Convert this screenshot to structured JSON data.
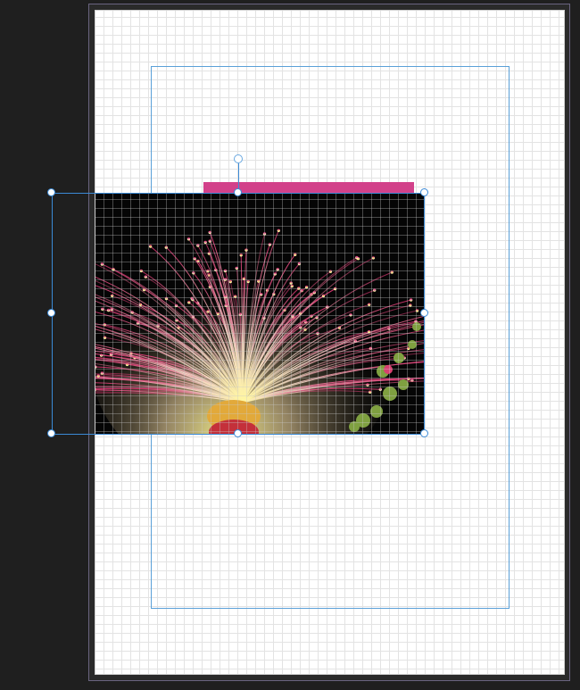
{
  "app": {
    "view": "layout-canvas"
  },
  "canvas": {
    "background_color": "#1f1f1f",
    "page_color": "#ffffff",
    "grid_color": "#e3e3e3",
    "guide_color": "#5aa0d8",
    "selection_color": "#3b8ad6"
  },
  "elements": {
    "accent_bar_color": "#d2418a",
    "image": {
      "subject": "flower-photo",
      "description_icon": "image-icon"
    },
    "selection": {
      "handles": [
        "top-left",
        "top-center",
        "top-right",
        "middle-left",
        "middle-right",
        "bottom-left",
        "bottom-center",
        "bottom-right"
      ],
      "rotate_handle": "rotate-handle"
    }
  }
}
